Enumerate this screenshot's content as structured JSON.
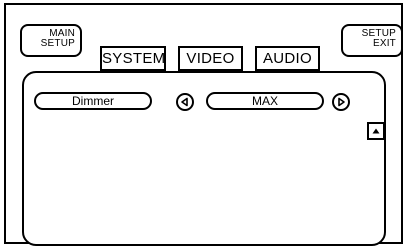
{
  "header": {
    "main_setup": {
      "line1": "MAIN",
      "line2": "SETUP"
    },
    "setup_exit": {
      "line1": "SETUP",
      "line2": "EXIT"
    }
  },
  "tabs": [
    {
      "label": "SYSTEM",
      "selected": false
    },
    {
      "label": "VIDEO",
      "selected": false
    },
    {
      "label": "AUDIO",
      "selected": false
    }
  ],
  "setting": {
    "name": "Dimmer",
    "value": "MAX",
    "prev_icon": "triangle-left-icon",
    "next_icon": "triangle-right-icon"
  },
  "scroll_up_icon": "triangle-up-icon",
  "colors": {
    "line": "#000000",
    "background": "#ffffff"
  }
}
